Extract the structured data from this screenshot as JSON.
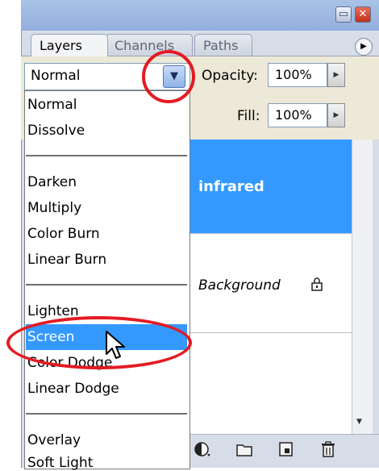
{
  "window": {
    "min_glyph": "▭",
    "close_glyph": "✕"
  },
  "tabs": [
    {
      "label": "Layers",
      "active": true
    },
    {
      "label": "Channels",
      "active": false
    },
    {
      "label": "Paths",
      "active": false
    }
  ],
  "panel_menu_glyph": "▶",
  "blend_mode": {
    "value": "Normal",
    "arrow_glyph": "▼"
  },
  "opacity": {
    "label": "Opacity:",
    "value": "100%"
  },
  "fill": {
    "label": "Fill:",
    "value": "100%"
  },
  "stepper_glyph": "▶",
  "layers": [
    {
      "name": "infrared",
      "selected": true
    },
    {
      "name": "Background",
      "selected": false,
      "locked": true
    }
  ],
  "dropdown": {
    "groups": [
      [
        "Normal",
        "Dissolve"
      ],
      [
        "Darken",
        "Multiply",
        "Color Burn",
        "Linear Burn"
      ],
      [
        "Lighten",
        "Screen",
        "Color Dodge",
        "Linear Dodge"
      ],
      [
        "Overlay",
        "Soft Light"
      ]
    ],
    "highlighted": "Screen"
  },
  "colors": {
    "highlight": "#3399ff",
    "annotation": "#e31b23",
    "panel": "#d6dde8"
  },
  "icons": [
    "adjustment-layer-icon",
    "new-group-icon",
    "new-layer-icon",
    "trash-icon",
    "lock-icon",
    "mouse-cursor-icon"
  ]
}
